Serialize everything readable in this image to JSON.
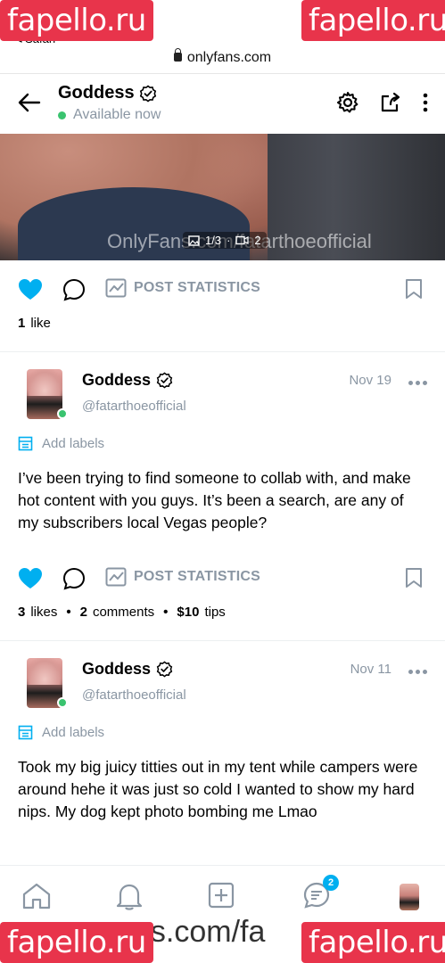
{
  "browser": {
    "back_label": "◂ Safari",
    "url": "onlyfans.com"
  },
  "header": {
    "title": "Goddess",
    "status": "Available now"
  },
  "media": {
    "watermark": "OnlyFans.com/fatarthoeofficial",
    "counter_images": "1/3",
    "counter_videos": "2"
  },
  "post0": {
    "stats_label": "POST STATISTICS",
    "likes_count": "1",
    "likes_word": "like"
  },
  "post1": {
    "name": "Goddess",
    "handle": "@fatarthoeofficial",
    "date": "Nov 19",
    "labels": "Add labels",
    "text": "I’ve been trying to find someone to collab with, and make hot content with you guys. It’s been a search, are any of my subscribers local Vegas people?",
    "stats_label": "POST STATISTICS",
    "likes_count": "3",
    "likes_word": "likes",
    "comments_count": "2",
    "comments_word": "comments",
    "tips_amount": "$10",
    "tips_word": "tips"
  },
  "post2": {
    "name": "Goddess",
    "handle": "@fatarthoeofficial",
    "date": "Nov 11",
    "labels": "Add labels",
    "text": "Took my big juicy titties out in my tent while campers were around hehe it was just so cold I wanted to show my hard nips. My dog kept photo bombing me Lmao"
  },
  "nav": {
    "messages_badge": "2"
  },
  "footer_url": "ns.com/fa",
  "watermarks": {
    "text": "fapello.ru"
  },
  "colors": {
    "accent": "#00aff0",
    "online": "#3ac36f",
    "muted": "#8a96a3",
    "watermark_bg": "#e8344b"
  }
}
